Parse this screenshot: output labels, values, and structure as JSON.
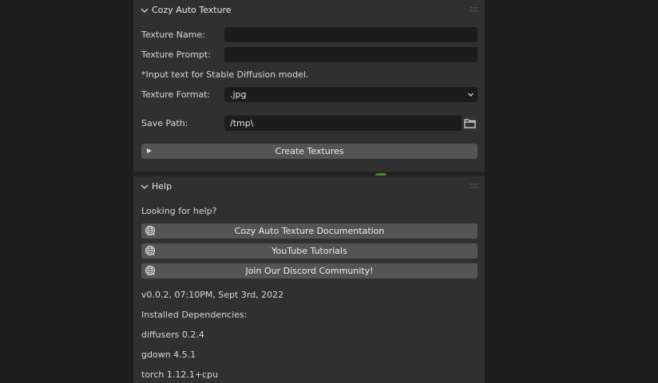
{
  "cozy_panel": {
    "title": "Cozy Auto Texture",
    "texture_name": {
      "label": "Texture Name:",
      "value": ""
    },
    "texture_prompt": {
      "label": "Texture Prompt:",
      "value": ""
    },
    "hint": "*Input text for Stable Diffusion model.",
    "texture_format": {
      "label": "Texture Format:",
      "value": ".jpg"
    },
    "save_path": {
      "label": "Save Path:",
      "value": "/tmp\\"
    },
    "create_button": "Create Textures"
  },
  "help_panel": {
    "title": "Help",
    "intro": "Looking for help?",
    "buttons": [
      "Cozy Auto Texture Documentation",
      "YouTube Tutorials",
      "Join Our Discord Community!"
    ],
    "version": "v0.0.2, 07:10PM, Sept 3rd, 2022",
    "deps_label": "Installed Dependencies:",
    "dependencies": [
      "diffusers 0.2.4",
      "gdown 4.5.1",
      "torch 1.12.1+cpu"
    ]
  },
  "icons": {
    "panel_collapse": "chevron-down-icon",
    "drag_handle": "grip-dots-icon",
    "dropdown": "chevron-down-icon",
    "browse": "folder-icon",
    "create": "play-triangle-icon",
    "url": "globe-icon"
  },
  "colors": {
    "panel_bg": "#303030",
    "field_bg": "#1c1c1c",
    "button_bg": "#545454",
    "outer_bg": "#1d1d1d",
    "accent_glow": "#4a8a21"
  }
}
